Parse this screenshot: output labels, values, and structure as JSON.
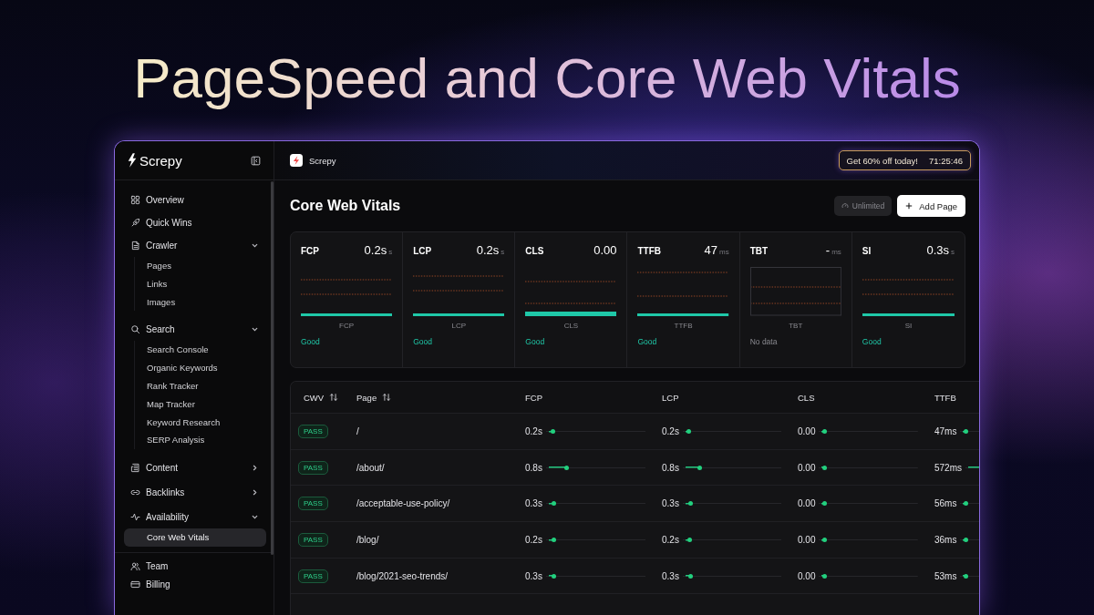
{
  "headline": "PageSpeed and Core Web Vitals",
  "sidebar": {
    "brand": "Screpy",
    "items": [
      {
        "label": "Overview",
        "selected": false
      },
      {
        "label": "Quick Wins",
        "selected": false
      },
      {
        "label": "Crawler",
        "selected": false,
        "expanded": true,
        "children": [
          {
            "label": "Pages",
            "selected": false
          },
          {
            "label": "Links",
            "selected": false
          },
          {
            "label": "Images",
            "selected": false
          }
        ]
      },
      {
        "label": "Search",
        "selected": false,
        "expanded": true,
        "children": [
          {
            "label": "Search Console",
            "selected": false
          },
          {
            "label": "Organic Keywords",
            "selected": false
          },
          {
            "label": "Rank Tracker",
            "selected": false
          },
          {
            "label": "Map Tracker",
            "selected": false
          },
          {
            "label": "Keyword Research",
            "selected": false
          },
          {
            "label": "SERP Analysis",
            "selected": false
          }
        ]
      },
      {
        "label": "Content",
        "selected": false,
        "expanded": false
      },
      {
        "label": "Backlinks",
        "selected": false,
        "expanded": false
      },
      {
        "label": "Availability",
        "selected": false,
        "expanded": true,
        "children": [
          {
            "label": "Core Web Vitals",
            "selected": true
          }
        ]
      }
    ],
    "footer_items": [
      {
        "label": "Team",
        "selected": false
      },
      {
        "label": "Billing",
        "selected": false
      }
    ]
  },
  "topbar": {
    "app_name": "Screpy",
    "promo": "Get 60% off today!",
    "countdown": "71:25:46"
  },
  "page": {
    "title": "Core Web Vitals",
    "plan_badge": "Unlimited",
    "add_button": "Add Page"
  },
  "metrics": [
    {
      "name": "FCP",
      "value": "0.2s",
      "unit": "s",
      "axis_label": "FCP",
      "kind": "good",
      "status": "Good"
    },
    {
      "name": "LCP",
      "value": "0.2s",
      "unit": "s",
      "axis_label": "LCP",
      "kind": "good",
      "status": "Good"
    },
    {
      "name": "CLS",
      "value": "0.00",
      "axis_label": "CLS",
      "kind": "good",
      "status": "Good"
    },
    {
      "name": "TTFB",
      "value": "47",
      "unit": "ms",
      "axis_label": "TTFB",
      "kind": "good",
      "status": "Good"
    },
    {
      "name": "TBT",
      "value": "-",
      "unit": "ms",
      "axis_label": "TBT",
      "kind": "none",
      "status": "No data"
    },
    {
      "name": "SI",
      "value": "0.3s",
      "unit": "s",
      "axis_label": "SI",
      "kind": "good",
      "status": "Good"
    }
  ],
  "table": {
    "columns": [
      {
        "label": "CWV",
        "sortable": true
      },
      {
        "label": "Page",
        "sortable": true
      },
      {
        "label": "FCP",
        "sortable": false
      },
      {
        "label": "LCP",
        "sortable": false
      },
      {
        "label": "CLS",
        "sortable": false
      },
      {
        "label": "TTFB",
        "sortable": false
      }
    ],
    "rows": [
      {
        "cwv": "PASS",
        "page": "/",
        "metrics": [
          {
            "value": "0.2s",
            "level": 0.04
          },
          {
            "value": "0.2s",
            "level": 0.03
          },
          {
            "value": "0.00",
            "level": 0.02
          },
          {
            "value": "47ms",
            "level": 0.03
          }
        ]
      },
      {
        "cwv": "PASS",
        "page": "/about/",
        "metrics": [
          {
            "value": "0.8s",
            "level": 0.18
          },
          {
            "value": "0.8s",
            "level": 0.14
          },
          {
            "value": "0.00",
            "level": 0.02
          },
          {
            "value": "572ms",
            "level": 0.3
          }
        ]
      },
      {
        "cwv": "PASS",
        "page": "/acceptable-use-policy/",
        "metrics": [
          {
            "value": "0.3s",
            "level": 0.05
          },
          {
            "value": "0.3s",
            "level": 0.05
          },
          {
            "value": "0.00",
            "level": 0.02
          },
          {
            "value": "56ms",
            "level": 0.03
          }
        ]
      },
      {
        "cwv": "PASS",
        "page": "/blog/",
        "metrics": [
          {
            "value": "0.2s",
            "level": 0.05
          },
          {
            "value": "0.2s",
            "level": 0.04
          },
          {
            "value": "0.00",
            "level": 0.02
          },
          {
            "value": "36ms",
            "level": 0.03
          }
        ]
      },
      {
        "cwv": "PASS",
        "page": "/blog/2021-seo-trends/",
        "metrics": [
          {
            "value": "0.3s",
            "level": 0.05
          },
          {
            "value": "0.3s",
            "level": 0.05
          },
          {
            "value": "0.00",
            "level": 0.02
          },
          {
            "value": "53ms",
            "level": 0.03
          }
        ]
      }
    ]
  }
}
